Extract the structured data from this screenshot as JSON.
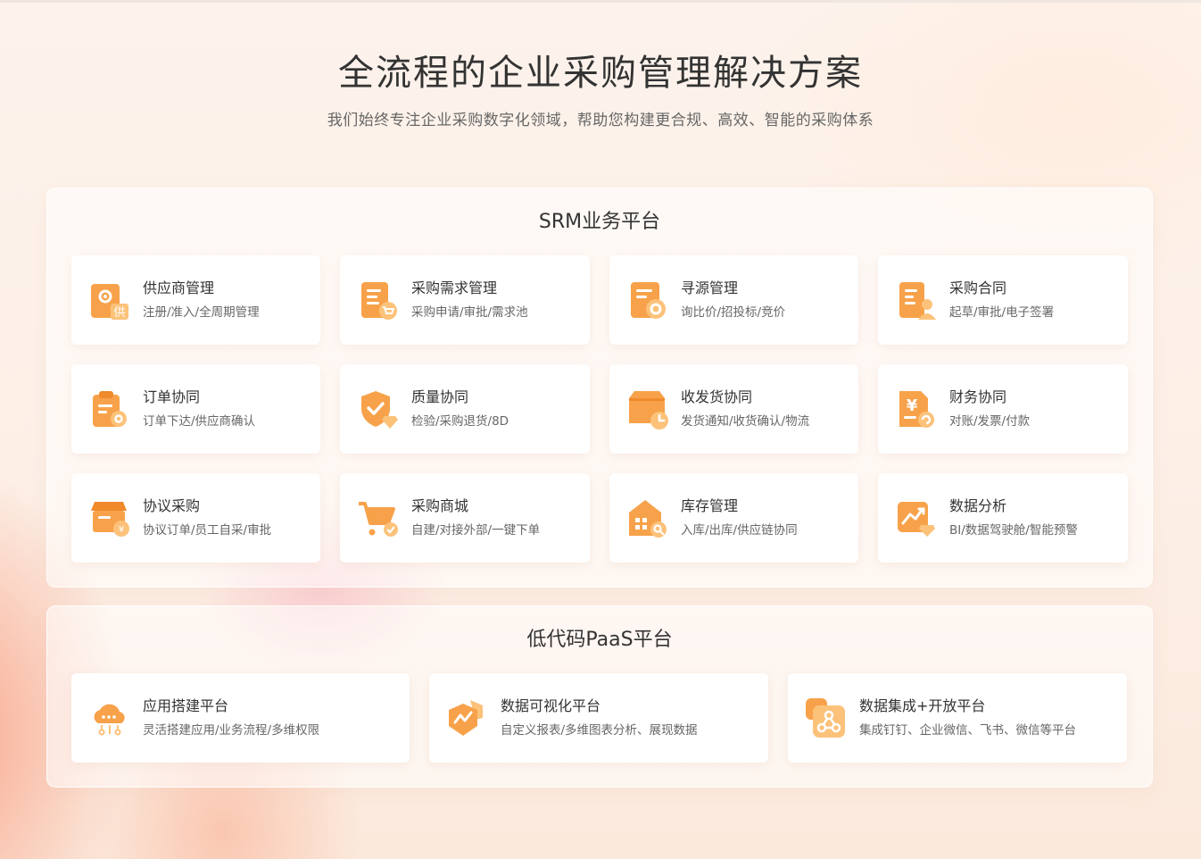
{
  "header": {
    "title": "全流程的企业采购管理解决方案",
    "subtitle": "我们始终专注企业采购数字化领域，帮助您构建更合规、高效、智能的采购体系"
  },
  "colors": {
    "accent": "#f7a24a",
    "accent_light": "#fcd49a",
    "accent_dark": "#f08a2c"
  },
  "srm": {
    "title": "SRM业务平台",
    "items": [
      {
        "name": "供应商管理",
        "desc": "注册/准入/全周期管理",
        "icon": "supplier-icon",
        "badge": "供"
      },
      {
        "name": "采购需求管理",
        "desc": "采购申请/审批/需求池",
        "icon": "purchase-demand-icon"
      },
      {
        "name": "寻源管理",
        "desc": "询比价/招投标/竞价",
        "icon": "sourcing-icon"
      },
      {
        "name": "采购合同",
        "desc": "起草/审批/电子签署",
        "icon": "contract-icon"
      },
      {
        "name": "订单协同",
        "desc": "订单下达/供应商确认",
        "icon": "order-icon"
      },
      {
        "name": "质量协同",
        "desc": "检验/采购退货/8D",
        "icon": "quality-shield-icon"
      },
      {
        "name": "收发货协同",
        "desc": "发货通知/收货确认/物流",
        "icon": "delivery-box-icon"
      },
      {
        "name": "财务协同",
        "desc": "对账/发票/付款",
        "icon": "finance-yen-icon",
        "badge": "¥"
      },
      {
        "name": "协议采购",
        "desc": "协议订单/员工自采/审批",
        "icon": "agreement-store-icon"
      },
      {
        "name": "采购商城",
        "desc": "自建/对接外部/一键下单",
        "icon": "shopping-cart-icon"
      },
      {
        "name": "库存管理",
        "desc": "入库/出库/供应链协同",
        "icon": "warehouse-icon"
      },
      {
        "name": "数据分析",
        "desc": "BI/数据驾驶舱/智能预警",
        "icon": "data-analysis-icon"
      }
    ]
  },
  "paas": {
    "title": "低代码PaaS平台",
    "items": [
      {
        "name": "应用搭建平台",
        "desc": "灵活搭建应用/业务流程/多维权限",
        "icon": "cloud-build-icon"
      },
      {
        "name": "数据可视化平台",
        "desc": "自定义报表/多维图表分析、展现数据",
        "icon": "data-visual-icon"
      },
      {
        "name": "数据集成+开放平台",
        "desc": "集成钉钉、企业微信、飞书、微信等平台",
        "icon": "integration-icon"
      }
    ]
  }
}
